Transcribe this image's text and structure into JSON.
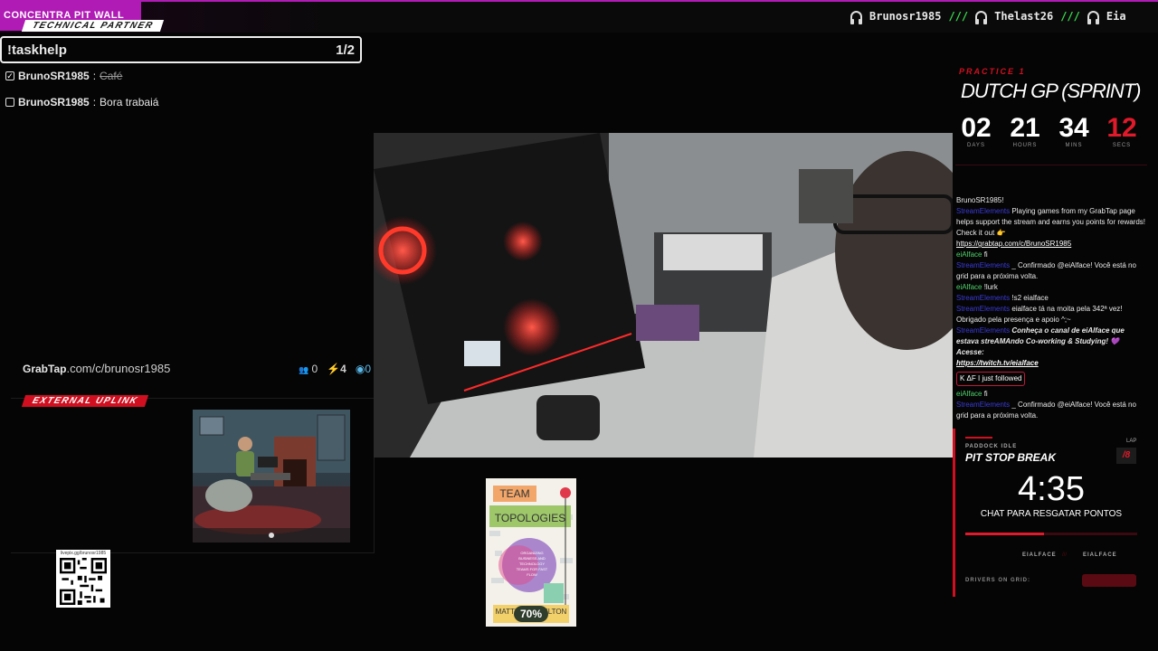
{
  "topbar": {
    "brand": "CONCENTRA PIT WALL",
    "ticker": [
      {
        "name": "Brunosr1985",
        "icon": "headphones-icon"
      },
      {
        "name": "Thelast26",
        "icon": "headphones-icon"
      },
      {
        "name": "Eia",
        "icon": "headphones-icon"
      }
    ],
    "separator": "///"
  },
  "tasks": {
    "partner_label": "TECHNICAL PARTNER",
    "command": "!taskhelp",
    "page": "1/2",
    "items": [
      {
        "user": "BrunoSR1985",
        "sep": ":",
        "text": "Café",
        "done": true
      },
      {
        "user": "BrunoSR1985",
        "sep": ":",
        "text": "Bora trabaiá",
        "done": false
      }
    ],
    "grabtap": {
      "logo": "GrabTap",
      "url": ".com/c/brunosr1985",
      "stat_users": "0",
      "stat_bolt": "4",
      "stat_points": "0"
    }
  },
  "uplink": {
    "label": "EXTERNAL UPLINK"
  },
  "qr": {
    "url": "livepix.gg/brunosr1985"
  },
  "book": {
    "title_1": "TEAM",
    "title_2": "TOPOLOGIES",
    "subtitle": "ORGANIZING BUSINESS AND TECHNOLOGY TEAMS FOR FAST FLOW",
    "authors": "MATTHEW SKELTON",
    "progress_percent": "70%",
    "progress": 0.7
  },
  "session": {
    "label": "PRACTICE 1",
    "title": "DUTCH GP (SPRINT)",
    "countdown": [
      {
        "value": "02",
        "unit": "DAYS",
        "highlight": false
      },
      {
        "value": "21",
        "unit": "HOURS",
        "highlight": false
      },
      {
        "value": "34",
        "unit": "MINS",
        "highlight": false
      },
      {
        "value": "12",
        "unit": "SECS",
        "highlight": true
      }
    ]
  },
  "chat": [
    {
      "user": "",
      "text": "BrunoSR1985!",
      "style": "plain"
    },
    {
      "user": "StreamElements",
      "text": "Playing games from my GrabTap page helps support the stream and earns you points for rewards! Check it out 👉",
      "style": "plain"
    },
    {
      "user": "",
      "text": "https://grabtap.com/c/BrunoSR1985",
      "style": "link"
    },
    {
      "user": "eiAlface",
      "text": "fi",
      "style": "green"
    },
    {
      "user": "StreamElements",
      "text": "_ Confirmado @eiAlface! Você está no grid para a próxima volta.",
      "style": "plain"
    },
    {
      "user": "eiAlface",
      "text": "!lurk",
      "style": "green"
    },
    {
      "user": "StreamElements",
      "text": "!s2 eialface",
      "style": "plain"
    },
    {
      "user": "StreamElements",
      "text": "eialface tá na moita pela 342ª vez! Obrigado pela presença e apoio ^;~",
      "style": "plain"
    },
    {
      "user": "StreamElements",
      "text": "Conheça o canal de eiAlface que estava streAMAndo Co-working & Studying! 💜 Acesse:",
      "style": "italic"
    },
    {
      "user": "",
      "text": "https://twitch.tv/eialface",
      "style": "italic-link"
    },
    {
      "user": "",
      "text": "K ΔF I just followed",
      "style": "follow"
    },
    {
      "user": "eiAlface",
      "text": "fi",
      "style": "green"
    },
    {
      "user": "StreamElements",
      "text": "_ Confirmado @eiAlface! Você está no grid para a próxima volta.",
      "style": "plain"
    }
  ],
  "pit": {
    "paddock": "PADDOCK IDLE",
    "title": "PIT STOP BREAK",
    "lap_label": "LAP",
    "lap": "/8",
    "timer": "4:35",
    "subtitle": "CHAT PARA RESGATAR PONTOS",
    "progress": 0.46,
    "driver_a": "EIALFACE",
    "driver_b": "EIALFACE",
    "drivers_label": "DRIVERS ON GRID:"
  },
  "colors": {
    "accent": "#b01ab5",
    "red": "#e01a2a",
    "green": "#3adb4e"
  }
}
